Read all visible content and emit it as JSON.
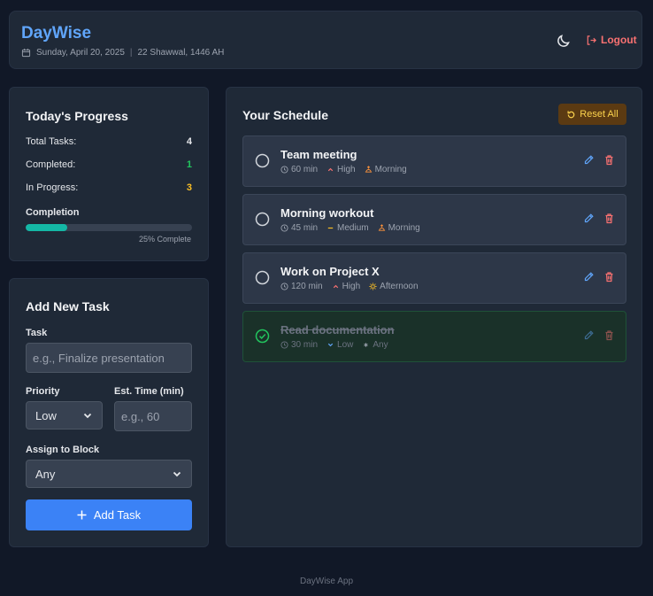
{
  "header": {
    "title": "DayWise",
    "date": "Sunday, April 20, 2025",
    "hijri": "22 Shawwal, 1446 AH",
    "logout_label": "Logout"
  },
  "progress": {
    "title": "Today's Progress",
    "total_label": "Total Tasks:",
    "total_value": "4",
    "completed_label": "Completed:",
    "completed_value": "1",
    "in_progress_label": "In Progress:",
    "in_progress_value": "3",
    "completion_label": "Completion",
    "completion_percent": 25,
    "completion_text": "25% Complete"
  },
  "add_task": {
    "title": "Add New Task",
    "task_label": "Task",
    "task_placeholder": "e.g., Finalize presentation",
    "priority_label": "Priority",
    "priority_value": "Low",
    "time_label": "Est. Time (min)",
    "time_placeholder": "e.g., 60",
    "block_label": "Assign to Block",
    "block_value": "Any",
    "button_label": "Add Task"
  },
  "schedule": {
    "title": "Your Schedule",
    "reset_label": "Reset All",
    "tasks": [
      {
        "title": "Team meeting",
        "time": "60 min",
        "priority": "High",
        "block": "Morning",
        "done": false
      },
      {
        "title": "Morning workout",
        "time": "45 min",
        "priority": "Medium",
        "block": "Morning",
        "done": false
      },
      {
        "title": "Work on Project X",
        "time": "120 min",
        "priority": "High",
        "block": "Afternoon",
        "done": false
      },
      {
        "title": "Read documentation",
        "time": "30 min",
        "priority": "Low",
        "block": "Any",
        "done": true
      }
    ]
  },
  "footer": {
    "text": "DayWise App"
  },
  "colors": {
    "accent": "#3b82f6",
    "brand": "#60a5fa",
    "success": "#22c55e",
    "warning": "#fbbf24",
    "danger": "#f87171"
  }
}
